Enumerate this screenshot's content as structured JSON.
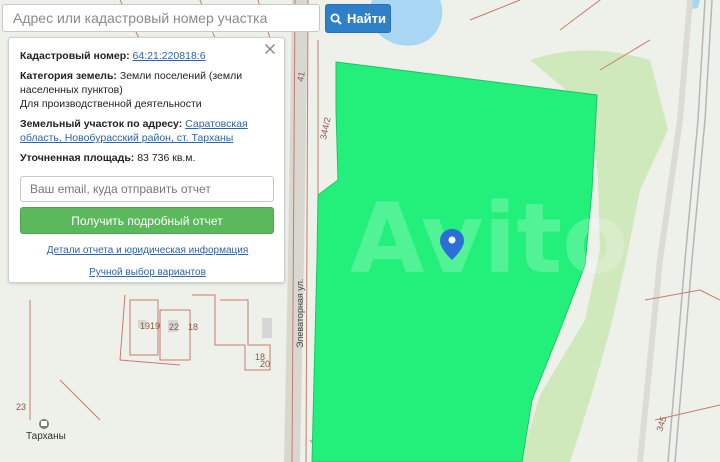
{
  "search": {
    "placeholder": "Адрес или кадастровый номер участка",
    "button_label": "Найти"
  },
  "card": {
    "cadastral_label": "Кадастровый номер:",
    "cadastral_value": "64:21:220818:6",
    "category_label": "Категория земель:",
    "category_value": "Земли поселений (земли населенных пунктов)",
    "purpose_value": "Для производственной деятельности",
    "address_label": "Земельный участок по адресу:",
    "address_value": "Саратовская область, Новобурасский район, ст. Тарханы",
    "area_label": "Уточненная площадь:",
    "area_value": "83 736 кв.м.",
    "email_placeholder": "Ваш email, куда отправить отчет",
    "report_button": "Получить подробный отчет",
    "details_link": "Детали отчета и юридическая информация",
    "manual_link": "Ручной выбор вариантов"
  },
  "map": {
    "labels": {
      "parcel_41": "41",
      "parcel_344": "344/2",
      "parcel_19a": "19",
      "parcel_19b": "19",
      "parcel_22": "22",
      "parcel_18a": "18",
      "parcel_18b": "18",
      "parcel_20": "20",
      "parcel_23": "23",
      "parcel_345": "345",
      "street": "Элеваторная ул.",
      "town": "Тарханы",
      "watermark": "Avito"
    },
    "colors": {
      "parcel_fill": "#22f07a",
      "water": "#a9d6f2",
      "forest": "#cfe8bc",
      "boundary": "#c97b6e",
      "marker": "#2b6fd6",
      "search_button": "#2f7fc9",
      "report_button": "#5cb85c"
    }
  }
}
